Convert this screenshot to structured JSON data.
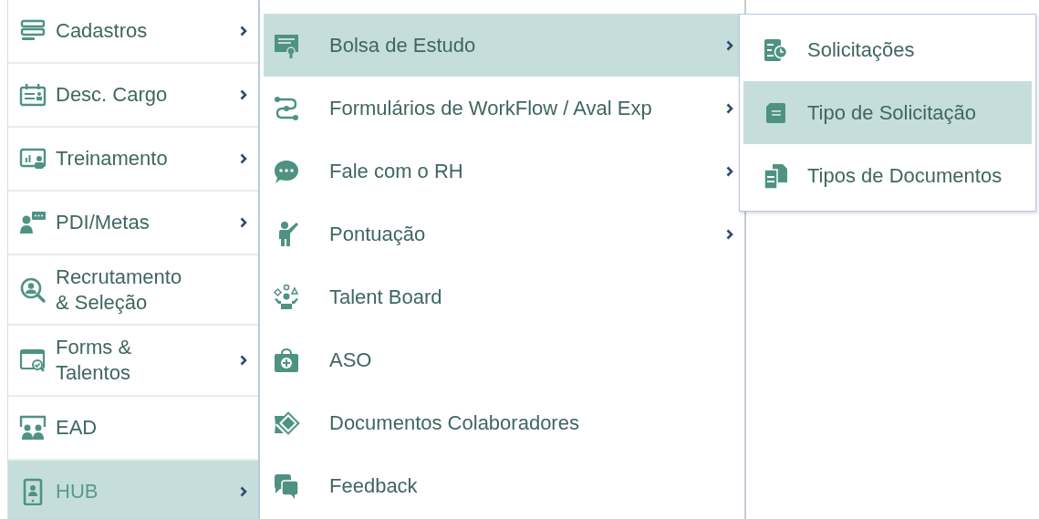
{
  "main_menu": [
    {
      "label": "Cadastros",
      "has_submenu": true,
      "selected": false
    },
    {
      "label": "Desc. Cargo",
      "has_submenu": true,
      "selected": false
    },
    {
      "label": "Treinamento",
      "has_submenu": true,
      "selected": false
    },
    {
      "label": "PDI/Metas",
      "has_submenu": true,
      "selected": false
    },
    {
      "label": "Recrutamento\n& Seleção",
      "has_submenu": false,
      "selected": false
    },
    {
      "label": "Forms &\nTalentos",
      "has_submenu": true,
      "selected": false
    },
    {
      "label": "EAD",
      "has_submenu": false,
      "selected": false
    },
    {
      "label": "HUB",
      "has_submenu": true,
      "selected": true
    }
  ],
  "hub_menu": [
    {
      "label": "Bolsa de Estudo",
      "has_submenu": true,
      "selected": true
    },
    {
      "label": "Formulários de WorkFlow / Aval Exp",
      "has_submenu": true,
      "selected": false
    },
    {
      "label": "Fale com o RH",
      "has_submenu": true,
      "selected": false
    },
    {
      "label": "Pontuação",
      "has_submenu": true,
      "selected": false
    },
    {
      "label": "Talent Board",
      "has_submenu": false,
      "selected": false
    },
    {
      "label": "ASO",
      "has_submenu": false,
      "selected": false
    },
    {
      "label": "Documentos Colaboradores",
      "has_submenu": false,
      "selected": false
    },
    {
      "label": "Feedback",
      "has_submenu": false,
      "selected": false
    }
  ],
  "bolsa_menu": [
    {
      "label": "Solicitações",
      "selected": false
    },
    {
      "label": "Tipo de Solicitação",
      "selected": true
    },
    {
      "label": "Tipos de Documentos",
      "selected": false
    }
  ]
}
